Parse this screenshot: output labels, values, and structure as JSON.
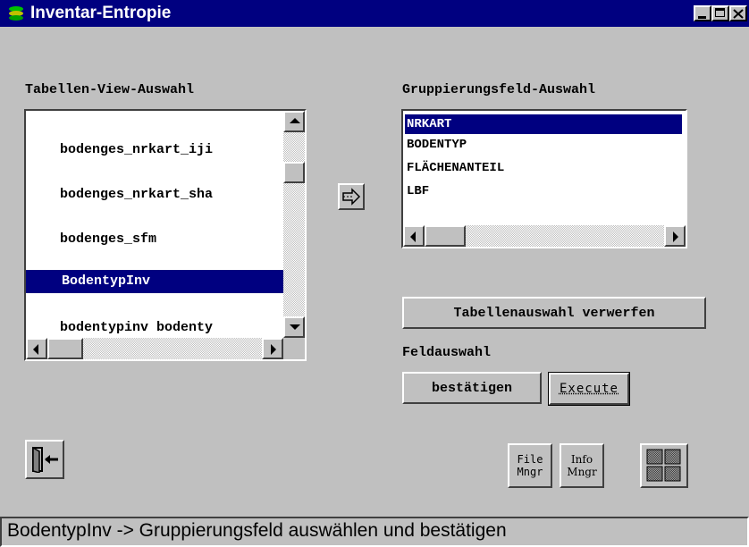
{
  "window": {
    "title": "Inventar-Entropie",
    "controls": [
      "minimize-icon",
      "maximize-icon",
      "close-icon"
    ]
  },
  "left_panel": {
    "label": "Tabellen-View-Auswahl",
    "items": [
      {
        "label": "bodenges_nrkart_iji",
        "selected": false
      },
      {
        "label": "bodenges_nrkart_sha",
        "selected": false
      },
      {
        "label": "bodenges_sfm",
        "selected": false
      },
      {
        "label": "BodentypInv",
        "selected": true
      },
      {
        "label": "bodentypinv bodenty",
        "selected": false
      }
    ]
  },
  "transfer_button_icon": "arrow-right-icon",
  "right_panel": {
    "label": "Gruppierungsfeld-Auswahl",
    "items": [
      {
        "label": "NRKART",
        "selected": true
      },
      {
        "label": "BODENTYP",
        "selected": false
      },
      {
        "label": "FLÄCHENANTEIL",
        "selected": false
      },
      {
        "label": "LBF",
        "selected": false
      }
    ]
  },
  "buttons": {
    "discard": "Tabellenauswahl verwerfen",
    "field_selection_label": "Feldauswahl",
    "confirm": "bestätigen",
    "execute": "Execute",
    "file_manager": [
      "File",
      "Mngr"
    ],
    "info_manager": [
      "Info",
      "Mngr"
    ]
  },
  "icons": {
    "exit": "exit-door-icon",
    "grid": "grid-icon"
  },
  "status": "BodentypInv -> Gruppierungsfeld auswählen und bestätigen",
  "colors": {
    "titlebar": "#000080",
    "selection": "#000080",
    "background": "#c0c0c0"
  }
}
